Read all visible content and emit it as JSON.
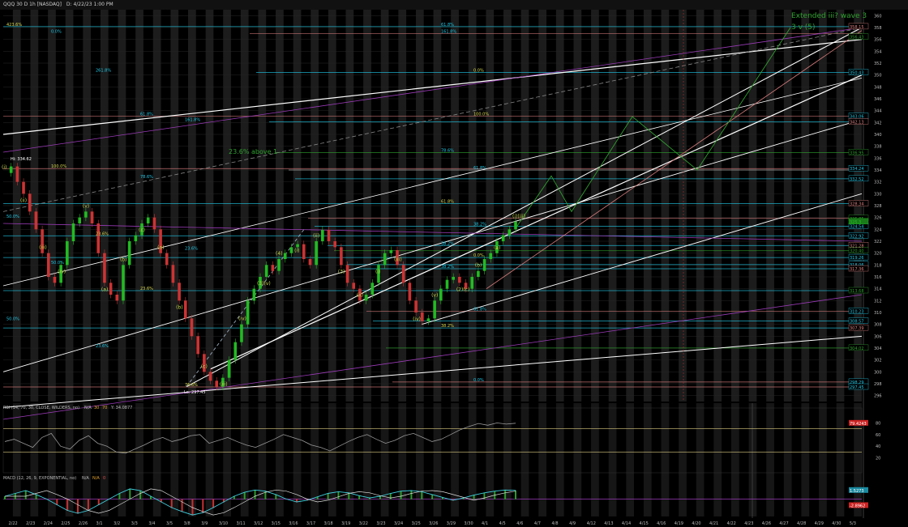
{
  "header": {
    "symbol_line": "QQQ 30 D 1h [NASDAQ]",
    "date_line": "D: 4/22/23 1:00 PM"
  },
  "annotations": {
    "title": "Extended iii? wave 3",
    "subtitle": "3 v (5)",
    "above1": "23.6% above 1",
    "hi_label": "Hi: 334.62",
    "lo_label": "Lo: 297.45"
  },
  "rsi_pane": {
    "label": "RSI (14, 70, 30, CLOSE, WILDERS, no)",
    "na": "N/A",
    "ob": "30",
    "os": "70",
    "value_text": "Y: 34.0877",
    "levels": {
      "upper": 70,
      "lower": 30
    },
    "current_tag": "79.4243"
  },
  "macd_pane": {
    "label": "MACD (12, 26, 9, EXPONENTIAL, no)",
    "vals": [
      "N/A",
      "N/A",
      "0"
    ],
    "tag1": "1.5273",
    "tag2": "-2.8962"
  },
  "colors": {
    "bg": "#000000",
    "bull": "#22bb22",
    "bear": "#cc3333",
    "fib": "#22c8e6",
    "green_line": "#2ea02e",
    "purple": "#9b3bb8",
    "channel": "#ffffff",
    "salmon": "#e08080",
    "grid": "#333333"
  },
  "chart_data": {
    "type": "line",
    "title": "QQQ 30 D 1h [NASDAQ]",
    "x_ticks": [
      "2/22",
      "2/23",
      "2/24",
      "2/25",
      "2/26",
      "3/1",
      "3/2",
      "3/3",
      "3/4",
      "3/5",
      "3/8",
      "3/9",
      "3/10",
      "3/11",
      "3/12",
      "3/15",
      "3/16",
      "3/17",
      "3/18",
      "3/19",
      "3/22",
      "3/23",
      "3/24",
      "3/25",
      "3/26",
      "3/29",
      "3/30",
      "4/1",
      "4/5",
      "4/6",
      "4/7",
      "4/8",
      "4/9",
      "4/12",
      "4/13",
      "4/14",
      "4/15",
      "4/16",
      "4/19",
      "4/20",
      "4/21",
      "4/22",
      "4/23",
      "4/26",
      "4/27",
      "4/28",
      "4/29",
      "4/30",
      "5/3"
    ],
    "ylim": [
      295,
      361
    ],
    "y_ticks": [
      296,
      298,
      300,
      302,
      304,
      306,
      308,
      310,
      312,
      314,
      316,
      318,
      320,
      322,
      324,
      326,
      328,
      330,
      332,
      334,
      336,
      338,
      340,
      342,
      344,
      346,
      348,
      350,
      352,
      354,
      356,
      358,
      360
    ],
    "price": [
      333.5,
      334.6,
      332,
      330,
      327,
      324,
      320,
      316,
      315,
      318,
      322,
      325,
      326,
      327,
      325,
      320,
      315,
      313,
      312,
      318,
      322,
      323,
      325,
      326,
      324,
      320,
      318,
      315,
      312,
      309,
      306,
      303,
      300,
      298.5,
      297.5,
      299,
      302,
      305,
      308,
      312,
      314,
      316,
      318,
      317,
      319,
      320,
      321,
      321.5,
      319,
      318,
      322,
      323.9,
      322,
      321,
      318,
      315,
      314,
      312,
      313,
      315,
      318,
      320,
      320.5,
      318,
      315,
      312,
      310,
      308.5,
      309,
      312,
      314,
      315.5,
      316,
      315,
      314,
      316,
      317,
      319,
      320,
      322,
      323,
      324,
      325.3
    ],
    "price_tags": [
      "358.15",
      "356.43",
      "350.43",
      "343.06",
      "342.13",
      "336.95",
      "334.24",
      "332.52",
      "328.34",
      "325.85",
      "324.54",
      "322.92",
      "321.28",
      "320.40",
      "319.26",
      "318.06",
      "317.36",
      "313.68",
      "310.23",
      "308.57",
      "307.39",
      "304.02",
      "298.29",
      "297.45",
      "325.3"
    ],
    "fib_labels": [
      "423.6%",
      "161.8%",
      "261.8%",
      "100.0%",
      "161.8%",
      "78.6%",
      "100.0%",
      "61.8%",
      "78.6%",
      "61.8%",
      "50.0%",
      "38.2%",
      "23.6%",
      "38.2%",
      "23.6%",
      "0.0%",
      "50.0%",
      "38.2%",
      "23.6%",
      "61.8%",
      "50.0%",
      "38.2%",
      "23.6%",
      "0.0%",
      "76.6%",
      "61.8%",
      "0.0%",
      "0.0%",
      "61.8%"
    ],
    "wave_labels": [
      "(i)",
      "(ii)",
      "(iii)",
      "(iv)",
      "(v)",
      "(a)",
      "(b)",
      "(c)",
      "(a)",
      "(b)",
      "(c)",
      "(iii)",
      "(iv)",
      "(3)(v)",
      "(4)",
      "(i)",
      "(ii)",
      "(3)",
      "(ii)",
      "(i)",
      "(iii)",
      "(iv)",
      "(v)",
      "(2)(c)",
      "(b)",
      "(a)",
      "(i)(iii)"
    ],
    "rsi": [
      48,
      52,
      45,
      38,
      55,
      62,
      40,
      35,
      50,
      58,
      45,
      40,
      30,
      28,
      35,
      42,
      50,
      55,
      48,
      52,
      58,
      60,
      45,
      50,
      55,
      48,
      42,
      38,
      45,
      52,
      60,
      55,
      50,
      42,
      38,
      32,
      40,
      48,
      55,
      60,
      52,
      45,
      50,
      58,
      62,
      55,
      48,
      52,
      60,
      68,
      74,
      79,
      76,
      80,
      78,
      79.4
    ],
    "macd": [
      0.5,
      1,
      1.5,
      0.8,
      0,
      -1,
      -2,
      -2.5,
      -2,
      -1,
      0,
      1,
      1.8,
      1.5,
      0.5,
      -0.5,
      -1.5,
      -2.2,
      -2.8,
      -2.4,
      -1.5,
      -0.5,
      0.5,
      1.2,
      1.6,
      1.4,
      0.8,
      0,
      -0.5,
      -0.2,
      0.4,
      1,
      1.3,
      1.1,
      0.6,
      0.2,
      0.5,
      1,
      1.4,
      1.5,
      1.3,
      0.8,
      0.3,
      -0.2,
      0.2,
      0.7,
      1.1,
      1.4,
      1.6,
      1.5273
    ]
  }
}
